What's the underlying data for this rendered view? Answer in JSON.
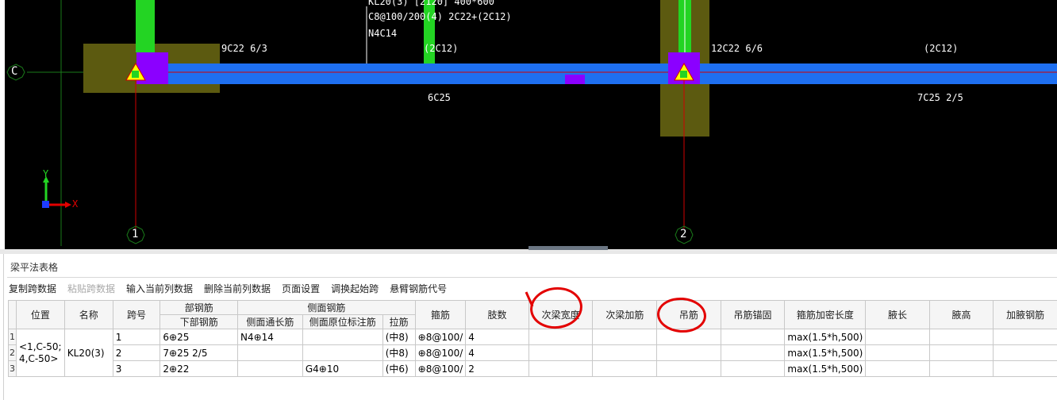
{
  "cad": {
    "axis_label_c": "C",
    "axis_label_1": "1",
    "axis_label_2": "2",
    "beam_annotation": [
      "KL20(3) [2120] 400*600",
      "C8@100/200(4) 2C22+(2C12)",
      "N4C14"
    ],
    "top_left_reinf": "9C22 6/3",
    "top_mid_reinf": "(2C12)",
    "top_right_reinf": "12C22 6/6",
    "top_far_right_reinf": "(2C12)",
    "bottom_span1": "6C25",
    "bottom_span2": "7C25 2/5",
    "ucs_y": "Y",
    "ucs_x": "X",
    "colors": {
      "beam": "#1e6ff0",
      "column": "#5c5a10",
      "rebar": "#23d423",
      "support": "#8b00ff",
      "axis": "#d10000",
      "grid": "#1a7a1a"
    }
  },
  "panel": {
    "title": "梁平法表格",
    "toolbar": [
      {
        "label": "复制跨数据",
        "enabled": true
      },
      {
        "label": "粘贴跨数据",
        "enabled": false
      },
      {
        "label": "输入当前列数据",
        "enabled": true
      },
      {
        "label": "删除当前列数据",
        "enabled": true
      },
      {
        "label": "页面设置",
        "enabled": true
      },
      {
        "label": "调换起始跨",
        "enabled": true
      },
      {
        "label": "悬臂钢筋代号",
        "enabled": true
      }
    ],
    "headers": {
      "position": "位置",
      "name": "名称",
      "span": "跨号",
      "bottom_group": "部钢筋",
      "bottom_rebar": "下部钢筋",
      "side_group": "侧面钢筋",
      "side_through": "侧面通长筋",
      "side_in_situ": "侧面原位标注筋",
      "tie": "拉筋",
      "stirrup": "箍筋",
      "legs": "肢数",
      "secondary_width": "次梁宽度",
      "secondary_add": "次梁加筋",
      "hanger": "吊筋",
      "hanger_anchor": "吊筋锚固",
      "dense_length": "箍筋加密长度",
      "haunch_length": "腋长",
      "haunch_height": "腋高",
      "haunch_rebar": "加腋钢筋"
    },
    "merged": {
      "position": "<1,C-50;\n4,C-50>",
      "name": "KL20(3)"
    },
    "rows": [
      {
        "rn": "1",
        "span": "1",
        "bottom": "6⊕25",
        "side_through": "N4⊕14",
        "side_in_situ": "",
        "tie": "(中8)",
        "stirrup": "⊕8@100/",
        "legs": "4",
        "dense": "max(1.5*h,500)"
      },
      {
        "rn": "2",
        "span": "2",
        "bottom": "7⊕25 2/5",
        "side_through": "",
        "side_in_situ": "",
        "tie": "(中8)",
        "stirrup": "⊕8@100/",
        "legs": "4",
        "dense": "max(1.5*h,500)"
      },
      {
        "rn": "3",
        "span": "3",
        "bottom": "2⊕22",
        "side_through": "",
        "side_in_situ": "G4⊕10",
        "tie": "(中6)",
        "stirrup": "⊕8@100/",
        "legs": "2",
        "dense": "max(1.5*h,500)"
      }
    ]
  }
}
